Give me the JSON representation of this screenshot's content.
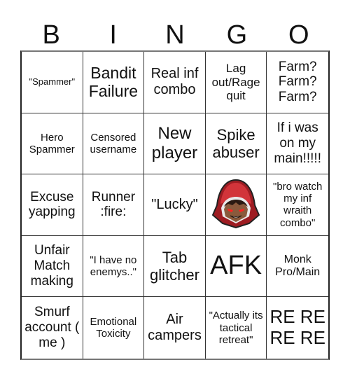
{
  "header": {
    "letters": [
      "B",
      "I",
      "N",
      "G",
      "O"
    ]
  },
  "cells": [
    "\"Spammer\"",
    "Bandit Failure",
    "Real inf combo",
    "Lag out/Rage quit",
    "Farm? Farm? Farm?",
    "Hero Spammer",
    "Censored username",
    "New player",
    "Spike abuser",
    "If i was on my main!!!!!",
    "Excuse yapping",
    "Runner :fire:",
    "\"Lucky\"",
    "",
    "\"bro watch my inf wraith combo\"",
    "Unfair Match making",
    "\"I have no enemys..\"",
    "Tab glitcher",
    "AFK",
    "Monk Pro/Main",
    "Smurf account ( me )",
    "Emotional Toxicity",
    "Air campers",
    "\"Actually its tactical retreat\"",
    "RE RE RE RE"
  ],
  "free_space": {
    "icon": "red-hooded-character-icon"
  },
  "colors": {
    "hood_red": "#c0272d",
    "skin": "#8a5a3c",
    "eyes": "#ff2020"
  }
}
